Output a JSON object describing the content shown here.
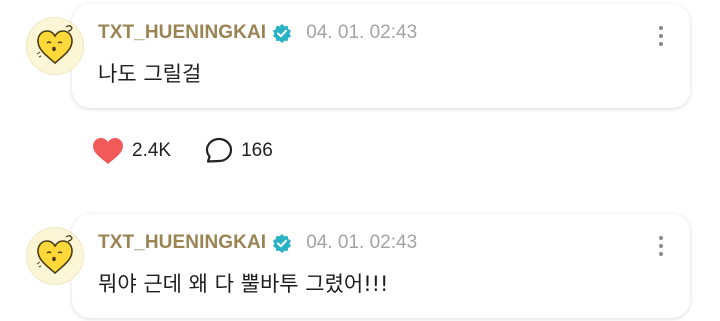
{
  "posts": [
    {
      "author": "TXT_HUENINGKAI",
      "verified": true,
      "timestamp": "04. 01. 02:43",
      "text": "나도 그릴걸",
      "avatar": "yellow-heart-avatar",
      "menu_icon": "more-vertical-icon"
    },
    {
      "author": "TXT_HUENINGKAI",
      "verified": true,
      "timestamp": "04. 01. 02:43",
      "text": "뭐야 근데 왜 다 뿔바투 그렸어!!!",
      "avatar": "yellow-heart-avatar",
      "menu_icon": "more-vertical-icon"
    }
  ],
  "actions": {
    "like_count": "2.4K",
    "comment_count": "166",
    "like_icon": "heart-icon",
    "comment_icon": "speech-bubble-icon"
  },
  "colors": {
    "author": "#9a8454",
    "timestamp": "#a3a3a3",
    "verified_badge": "#2ab3c4",
    "heart": "#f25a5a"
  }
}
